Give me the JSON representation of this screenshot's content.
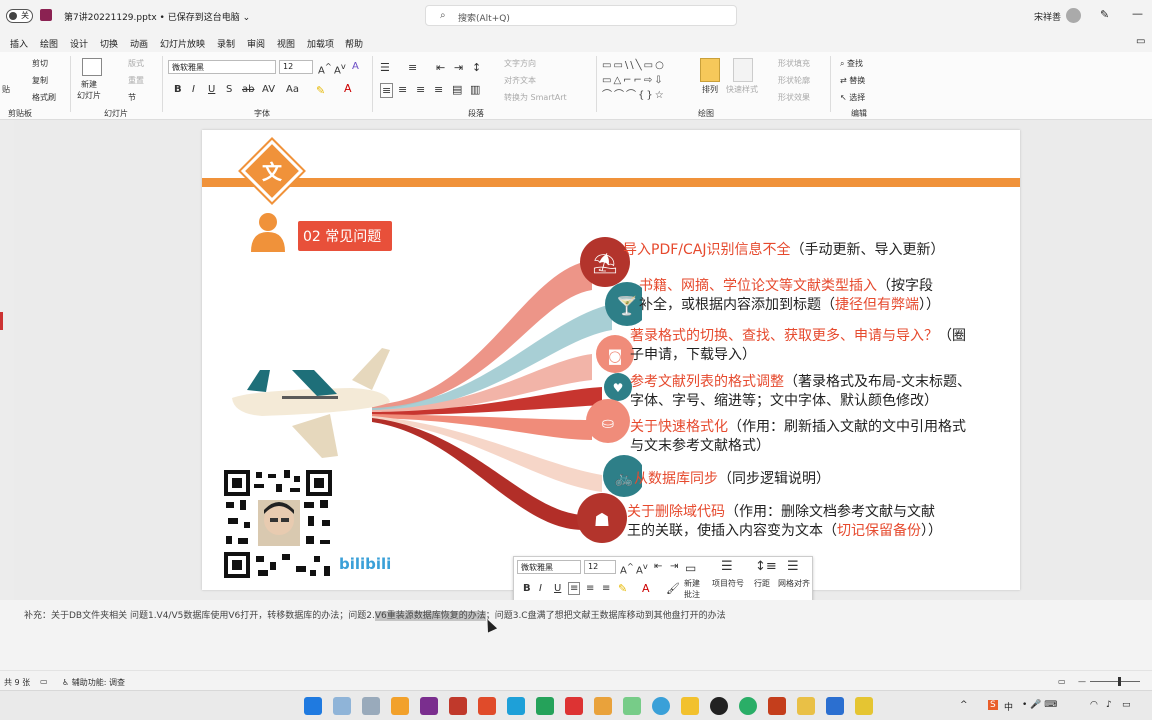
{
  "titlebar": {
    "toggle_label": "关",
    "doc_title": "第7讲20221129.pptx • 已保存到这台电脑 ⌄",
    "search_placeholder": "搜索(Alt+Q)",
    "user": "宋祥善"
  },
  "menu": [
    "插入",
    "绘图",
    "设计",
    "切换",
    "动画",
    "幻灯片放映",
    "录制",
    "审阅",
    "视图",
    "加载项",
    "帮助"
  ],
  "ribbon": {
    "clipboard": {
      "label": "剪贴板",
      "cut": "剪切",
      "copy": "复制",
      "painter": "格式刷",
      "paste": "贴"
    },
    "slides": {
      "label": "幻灯片",
      "new": "新建\n幻灯片",
      "layout": "版式",
      "reset": "重置",
      "section": "节"
    },
    "font": {
      "label": "字体",
      "name": "微软雅黑",
      "size": "12"
    },
    "paragraph": {
      "label": "段落",
      "direction": "文字方向",
      "align": "对齐文本",
      "smartart": "转换为 SmartArt"
    },
    "drawing": {
      "label": "绘图",
      "arrange": "排列",
      "quick_styles": "快速样式",
      "fill": "形状填充",
      "outline": "形状轮廓",
      "effects": "形状效果"
    },
    "editing": {
      "label": "编辑",
      "find": "查找",
      "replace": "替换",
      "select": "选择"
    }
  },
  "slide": {
    "badge_char": "文",
    "section_tag": "02 常见问题",
    "items": [
      {
        "hl": "导入PDF/CAJ识别信息不全",
        "rest": "（手动更新、导入更新）"
      },
      {
        "hl": "书籍、网摘、学位论文等文献类型插入",
        "rest": "（按字段",
        "line2a": "补全，或根据内容添加到标题（",
        "line2hl": "捷径但有弊端",
        "line2b": "））"
      },
      {
        "hl": "著录格式的切换、查找、获取更多、申请与导入？",
        "rest": "（圈",
        "line2a": "子申请，下载导入）"
      },
      {
        "hl": "参考文献列表的格式调整",
        "rest": "（著录格式及布局-文末标题、",
        "line2a": "字体、字号、缩进等；文中字体、默认颜色修改）"
      },
      {
        "hl": "关于快速格式化",
        "rest": "（作用：刷新插入文献的文中引用格式",
        "line2a": "与文末参考文献格式）"
      },
      {
        "hl": "从数据库同步",
        "rest": "（同步逻辑说明）"
      },
      {
        "hl": "关于删除域代码",
        "rest": "（作用：删除文档参考文献与文献",
        "line2a": "王的关联，使插入内容变为文本（",
        "line2hl": "切记保留备份",
        "line2b": "））"
      }
    ],
    "bili": "bilibili"
  },
  "minitoolbar": {
    "font": "微软雅黑",
    "size": "12",
    "new_comment": "新建\n批注",
    "bullets": "项目符号",
    "spacing": "行距",
    "distributed": "网格对齐"
  },
  "notes": {
    "pre": "补充：关于DB文件夹相关 问题1.V4/V5数据库使用V6打开，转移数据库的办法；问题2.",
    "selected": "V6重装源数据库恢复的办法",
    "post": "；问题3.C盘满了想把文献王数据库移动到其他盘打开的办法"
  },
  "status": {
    "slides": "共 9 张",
    "accessibility": "辅助功能: 调查"
  },
  "tray": {
    "ime": "中"
  },
  "colors": {
    "accent": "#f0923a",
    "highlight": "#e64a2e",
    "tag": "#e8503a"
  }
}
